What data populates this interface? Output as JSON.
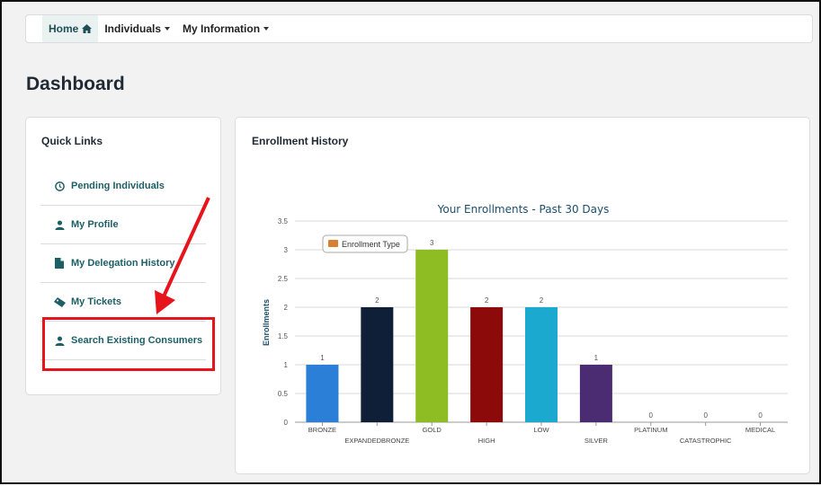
{
  "nav": {
    "home_label": "Home",
    "individuals_label": "Individuals",
    "my_information_label": "My Information"
  },
  "page": {
    "title": "Dashboard"
  },
  "quick_links": {
    "title": "Quick Links",
    "items": [
      {
        "label": "Pending Individuals",
        "icon": "clock-icon"
      },
      {
        "label": "My Profile",
        "icon": "user-icon"
      },
      {
        "label": "My Delegation History",
        "icon": "document-icon"
      },
      {
        "label": "My Tickets",
        "icon": "ticket-icon"
      },
      {
        "label": "Search Existing Consumers",
        "icon": "user-icon"
      }
    ]
  },
  "enrollment_card": {
    "title": "Enrollment History"
  },
  "annotation": {
    "color": "#e8141b"
  },
  "chart_data": {
    "type": "bar",
    "title": "Your Enrollments - Past 30 Days",
    "ylabel": "Enrollments",
    "xlabel": "",
    "ylim": [
      0,
      3.5
    ],
    "yticks": [
      "0",
      "0.5",
      "1",
      "1.5",
      "2",
      "2.5",
      "3",
      "3.5"
    ],
    "legend": {
      "label": "Enrollment Type",
      "color": "#d98030",
      "placement": "top-left"
    },
    "categories": [
      "BRONZE",
      "EXPANDEDBRONZE",
      "GOLD",
      "HIGH",
      "LOW",
      "SILVER",
      "PLATINUM",
      "CATASTROPHIC",
      "MEDICAL"
    ],
    "values": [
      1,
      2,
      3,
      2,
      2,
      1,
      0,
      0,
      0
    ],
    "colors": [
      "#2b7fd6",
      "#0f1f38",
      "#8dbd22",
      "#8c0a0a",
      "#1ba9cf",
      "#4b2b72",
      "#999999",
      "#999999",
      "#999999"
    ],
    "grid": true
  }
}
